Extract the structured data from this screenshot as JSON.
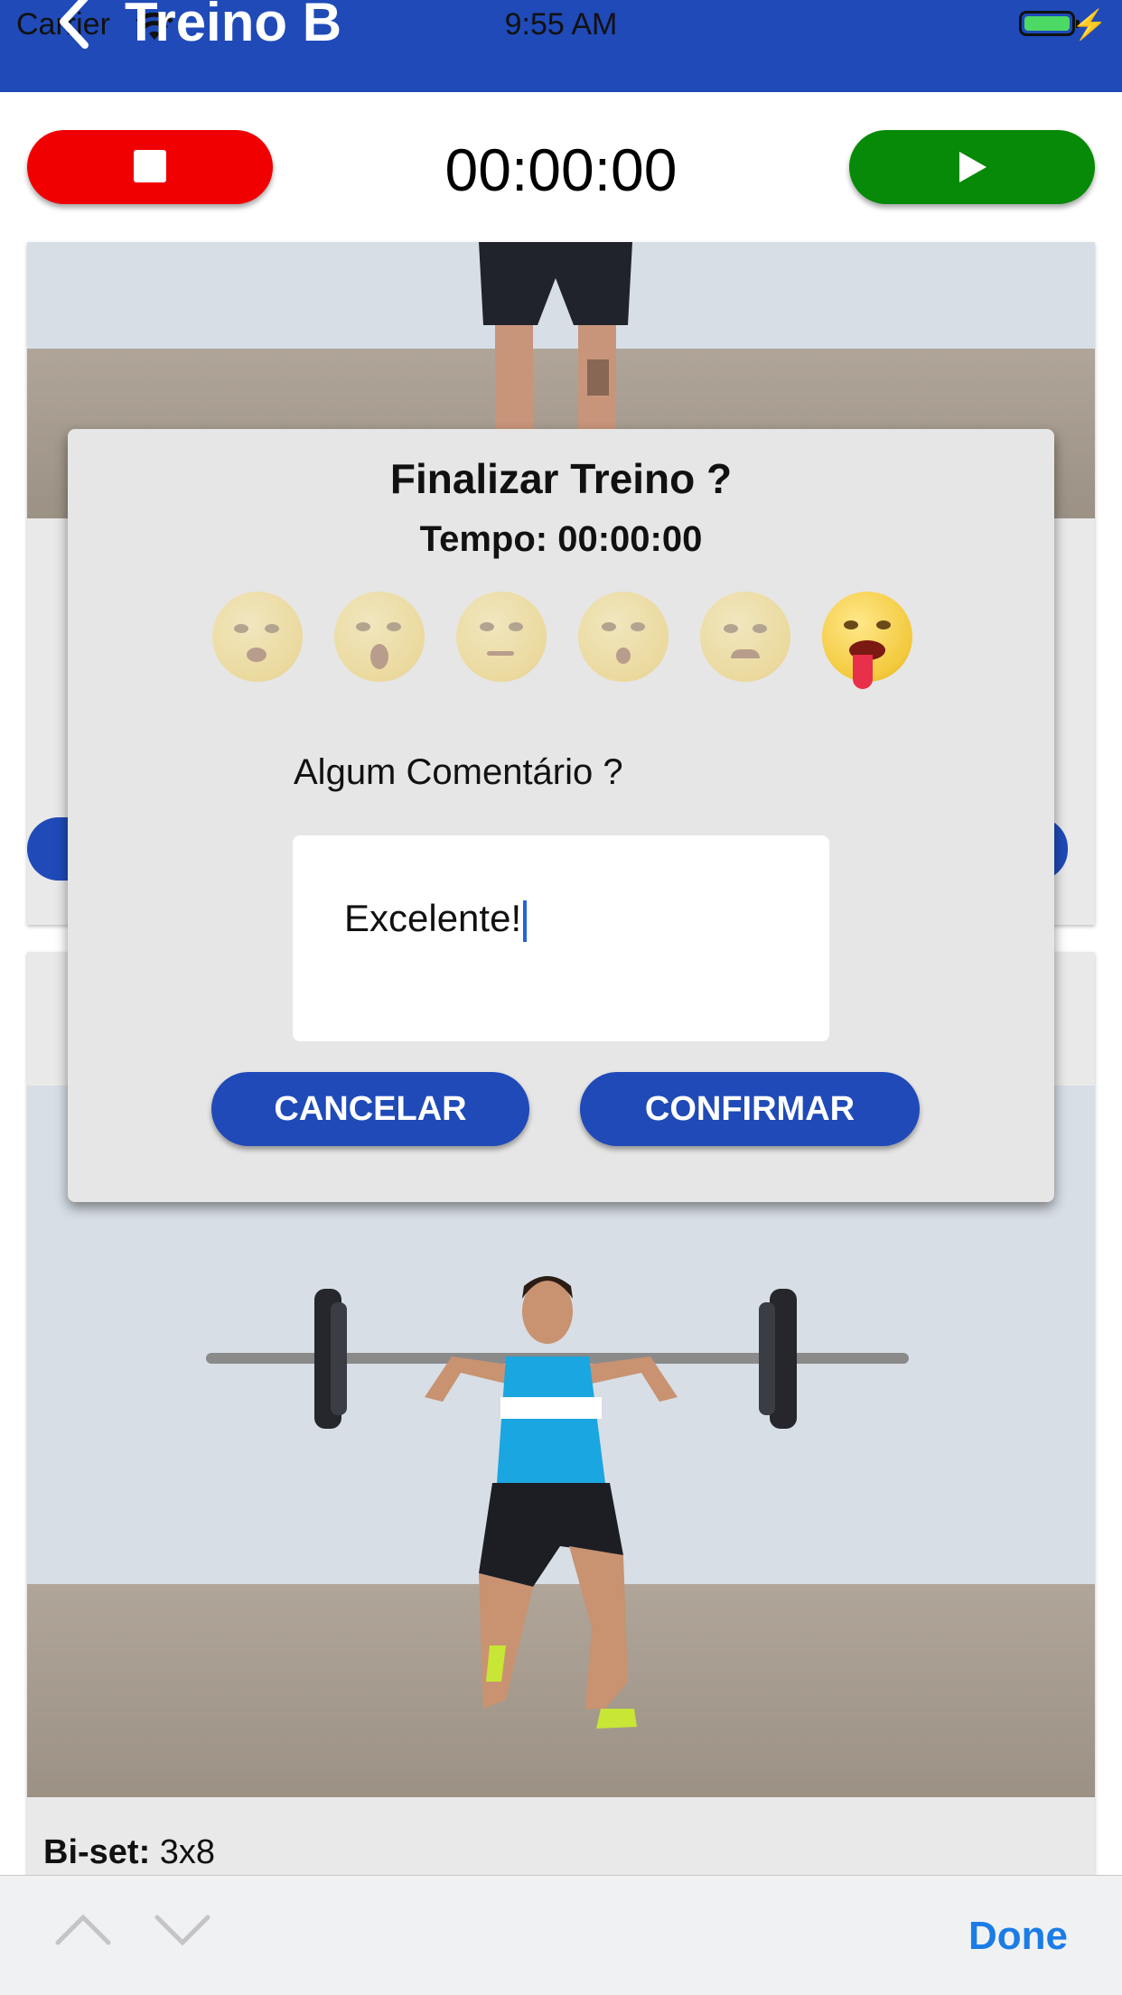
{
  "status_bar": {
    "carrier": "Carrier",
    "time": "9:55 AM",
    "battery_color": "#4cd964"
  },
  "nav": {
    "title": "Treino B",
    "back_icon": "chevron-left-icon",
    "background_color": "#1f4ab8"
  },
  "timer": {
    "display": "00:00:00",
    "stop_icon": "stop-icon",
    "play_icon": "play-icon",
    "stop_color": "#f00000",
    "play_color": "#078a07"
  },
  "exercise": {
    "label": "Bi-set:",
    "value": "3x8"
  },
  "dialog": {
    "title": "Finalizar Treino ?",
    "time_text": "Tempo: 00:00:00",
    "emoji_ratings": [
      {
        "icon": "relaxed-face-icon",
        "selected": false
      },
      {
        "icon": "yawning-face-icon",
        "selected": false
      },
      {
        "icon": "thinking-face-icon",
        "selected": false
      },
      {
        "icon": "surprised-face-icon",
        "selected": false
      },
      {
        "icon": "sad-face-icon",
        "selected": false
      },
      {
        "icon": "exhausted-face-icon",
        "selected": true
      }
    ],
    "comment_label": "Algum Comentário ?",
    "comment_value": "Excelente!",
    "cancel_label": "CANCELAR",
    "confirm_label": "CONFIRMAR",
    "accent_color": "#1f4ab8"
  },
  "keyboard_accessory": {
    "prev_icon": "chevron-up-icon",
    "next_icon": "chevron-down-icon",
    "done_label": "Done"
  }
}
